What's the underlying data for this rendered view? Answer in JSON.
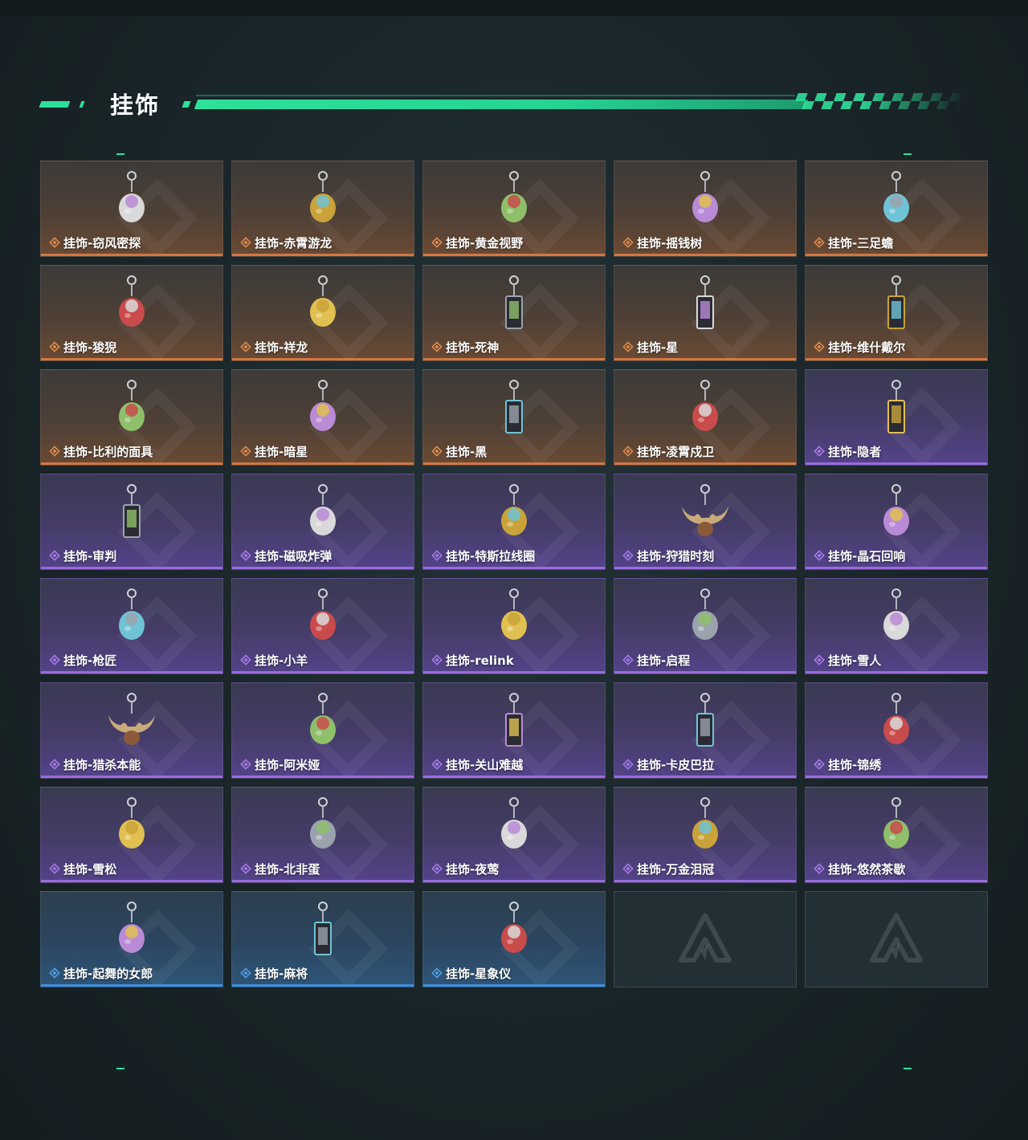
{
  "section": {
    "title": "挂饰"
  },
  "colors": {
    "accent": "#2ee09a",
    "orange": "#d4773f",
    "purple": "#9a6ae0",
    "blue": "#3f8fe0"
  },
  "items": [
    {
      "label": "挂饰-窃风密探",
      "rarity": "orange",
      "icon": "rabbit-charm-icon"
    },
    {
      "label": "挂饰-赤霄游龙",
      "rarity": "orange",
      "icon": "dragon-charm-icon"
    },
    {
      "label": "挂饰-黄金视野",
      "rarity": "orange",
      "icon": "cat-charm-icon"
    },
    {
      "label": "挂饰-摇钱树",
      "rarity": "orange",
      "icon": "money-tree-charm-icon"
    },
    {
      "label": "挂饰-三足蟾",
      "rarity": "orange",
      "icon": "toad-charm-icon"
    },
    {
      "label": "挂饰-狻猊",
      "rarity": "orange",
      "icon": "lion-charm-icon"
    },
    {
      "label": "挂饰-祥龙",
      "rarity": "orange",
      "icon": "auspicious-dragon-charm-icon"
    },
    {
      "label": "挂饰-死神",
      "rarity": "orange",
      "icon": "reaper-card-charm-icon"
    },
    {
      "label": "挂饰-星",
      "rarity": "orange",
      "icon": "star-card-charm-icon"
    },
    {
      "label": "挂饰-维什戴尔",
      "rarity": "orange",
      "icon": "tag-charm-icon"
    },
    {
      "label": "挂饰-比利的面具",
      "rarity": "orange",
      "icon": "billy-mask-charm-icon"
    },
    {
      "label": "挂饰-暗星",
      "rarity": "orange",
      "icon": "dark-star-charm-icon"
    },
    {
      "label": "挂饰-黑",
      "rarity": "orange",
      "icon": "black-tag-charm-icon"
    },
    {
      "label": "挂饰-凌霄戍卫",
      "rarity": "orange",
      "icon": "rocket-charm-icon"
    },
    {
      "label": "挂饰-隐者",
      "rarity": "purple",
      "icon": "hermit-card-charm-icon"
    },
    {
      "label": "挂饰-审判",
      "rarity": "purple",
      "icon": "judgement-card-charm-icon"
    },
    {
      "label": "挂饰-磁吸炸弹",
      "rarity": "purple",
      "icon": "magnetic-bomb-charm-icon"
    },
    {
      "label": "挂饰-特斯拉线圈",
      "rarity": "purple",
      "icon": "tesla-coil-charm-icon"
    },
    {
      "label": "挂饰-狩猎时刻",
      "rarity": "purple",
      "icon": "moose-antler-charm-icon"
    },
    {
      "label": "挂饰-晶石回响",
      "rarity": "purple",
      "icon": "crystal-charm-icon"
    },
    {
      "label": "挂饰-枪匠",
      "rarity": "purple",
      "icon": "gunsmith-charm-icon"
    },
    {
      "label": "挂饰-小羊",
      "rarity": "purple",
      "icon": "lamb-charm-icon"
    },
    {
      "label": "挂饰-relink",
      "rarity": "purple",
      "icon": "relink-shield-charm-icon"
    },
    {
      "label": "挂饰-启程",
      "rarity": "purple",
      "icon": "compass-charm-icon"
    },
    {
      "label": "挂饰-雪人",
      "rarity": "purple",
      "icon": "snowman-charm-icon"
    },
    {
      "label": "挂饰-猎杀本能",
      "rarity": "purple",
      "icon": "moose-antler-charm-icon"
    },
    {
      "label": "挂饰-阿米娅",
      "rarity": "purple",
      "icon": "amiya-charm-icon"
    },
    {
      "label": "挂饰-关山难越",
      "rarity": "purple",
      "icon": "yellow-bar-charm-icon"
    },
    {
      "label": "挂饰-卡皮巴拉",
      "rarity": "purple",
      "icon": "capybara-charm-icon"
    },
    {
      "label": "挂饰-锦绣",
      "rarity": "purple",
      "icon": "butterfly-charm-icon"
    },
    {
      "label": "挂饰-雪松",
      "rarity": "purple",
      "icon": "pine-tree-charm-icon"
    },
    {
      "label": "挂饰-北非蛋",
      "rarity": "purple",
      "icon": "shakshuka-charm-icon"
    },
    {
      "label": "挂饰-夜莺",
      "rarity": "purple",
      "icon": "nightingale-charm-icon"
    },
    {
      "label": "挂饰-万金泪冠",
      "rarity": "purple",
      "icon": "crown-charm-icon"
    },
    {
      "label": "挂饰-悠然茶歇",
      "rarity": "purple",
      "icon": "cupcake-charm-icon"
    },
    {
      "label": "挂饰-起舞的女郎",
      "rarity": "blue",
      "icon": "dancer-charm-icon"
    },
    {
      "label": "挂饰-麻将",
      "rarity": "blue",
      "icon": "mahjong-charm-icon"
    },
    {
      "label": "挂饰-星象仪",
      "rarity": "blue",
      "icon": "astrolabe-charm-icon"
    },
    {
      "label": "",
      "rarity": "empty",
      "icon": "empty-slot-logo-icon"
    },
    {
      "label": "",
      "rarity": "empty",
      "icon": "empty-slot-logo-icon"
    }
  ]
}
